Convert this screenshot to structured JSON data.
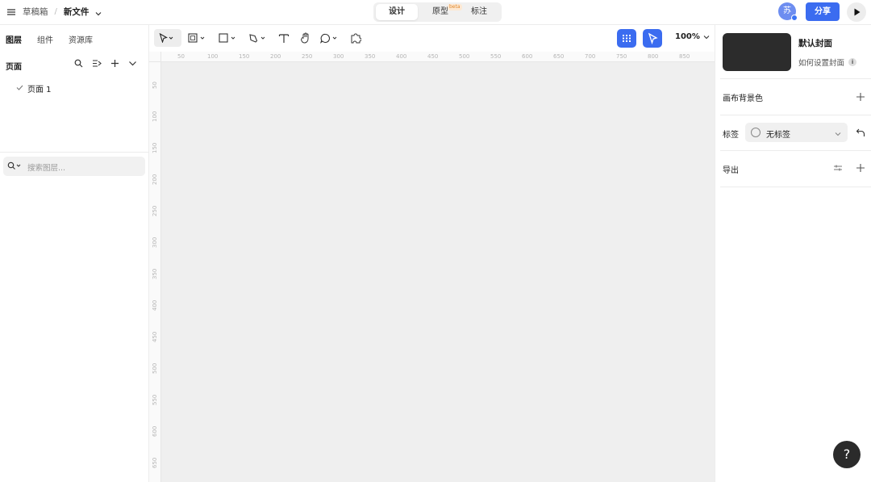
{
  "header": {
    "menu_icon": "hamburger-icon",
    "breadcrumb_parent": "草稿箱",
    "breadcrumb_sep": "/",
    "file_name": "新文件",
    "modes": [
      "设计",
      "原型",
      "标注"
    ],
    "active_mode": "设计",
    "beta_badge": "beta",
    "avatar_text": "苏",
    "share_label": "分享"
  },
  "left_panel": {
    "tabs": [
      "图层",
      "组件",
      "资源库"
    ],
    "active_tab": "图层",
    "pages_title": "页面",
    "pages": [
      {
        "label": "页面 1",
        "selected": true
      }
    ],
    "search_placeholder": "搜索图层..."
  },
  "toolbar": {
    "tools": [
      "move-tool-icon",
      "frame-tool-icon",
      "rectangle-tool-icon",
      "pen-tool-icon",
      "text-tool-icon",
      "hand-tool-icon",
      "comment-tool-icon",
      "plugin-icon"
    ],
    "zoom": "100%"
  },
  "rulers": {
    "horizontal": [
      "50",
      "100",
      "150",
      "200",
      "250",
      "300",
      "350",
      "400",
      "450",
      "500",
      "550",
      "600",
      "650",
      "700",
      "750",
      "800",
      "850"
    ],
    "vertical": [
      "50",
      "100",
      "150",
      "200",
      "250",
      "300",
      "350",
      "400",
      "450",
      "500",
      "550",
      "600",
      "650"
    ]
  },
  "right_panel": {
    "cover_title": "默认封面",
    "cover_help": "如何设置封面",
    "canvas_bg_label": "画布背景色",
    "tag_label": "标签",
    "tag_value": "无标签",
    "export_label": "导出"
  },
  "help_button": "?",
  "colors": {
    "accent": "#3b6cf0",
    "canvas": "#efefef",
    "cover": "#2c2c2c"
  }
}
